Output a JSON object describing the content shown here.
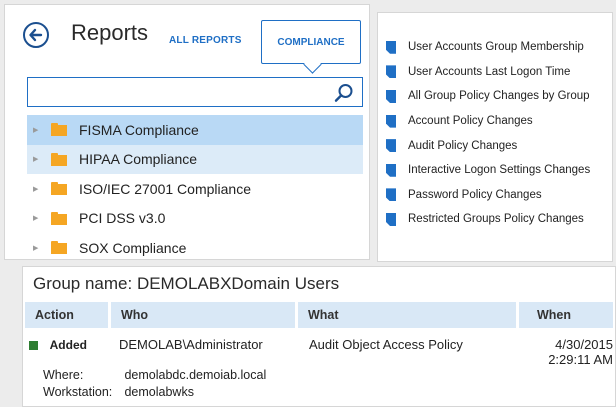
{
  "header": {
    "title": "Reports",
    "tab_all": "ALL REPORTS",
    "tab_compliance": "COMPLIANCE"
  },
  "search": {
    "placeholder": ""
  },
  "tree": [
    {
      "label": "FISMA Compliance",
      "state": "selected"
    },
    {
      "label": "HIPAA Compliance",
      "state": "hover"
    },
    {
      "label": "ISO/IEC 27001 Compliance",
      "state": "normal"
    },
    {
      "label": "PCI DSS v3.0",
      "state": "normal"
    },
    {
      "label": "SOX Compliance",
      "state": "normal"
    }
  ],
  "reports": [
    "User Accounts Group Membership",
    "User Accounts Last Logon Time",
    "All Group Policy Changes by Group",
    "Account Policy Changes",
    "Audit Policy Changes",
    "Interactive Logon Settings Changes",
    "Password Policy Changes",
    "Restricted Groups Policy Changes"
  ],
  "detail": {
    "group_title": "Group name: DEMOLABXDomain Users",
    "columns": {
      "action": "Action",
      "who": "Who",
      "what": "What",
      "when": "When"
    },
    "row": {
      "action": "Added",
      "who": "DEMOLAB\\Administrator",
      "what": "Audit Object Access Policy",
      "when_date": "4/30/2015",
      "when_time": "2:29:11 AM",
      "where_label": "Where:",
      "where_value": "demolabdc.demoiab.local",
      "workstation_label": "Workstation:",
      "workstation_value": "demolabwks"
    }
  },
  "colors": {
    "accent": "#1f6fc5",
    "selected_bg": "#b9d9f5",
    "hover_bg": "#dcebf8",
    "folder": "#f5a623",
    "added": "#2e7d32"
  },
  "icons": {
    "back": "back-arrow-circle-icon",
    "search": "search-icon",
    "folder": "folder-icon",
    "report": "report-document-icon"
  }
}
